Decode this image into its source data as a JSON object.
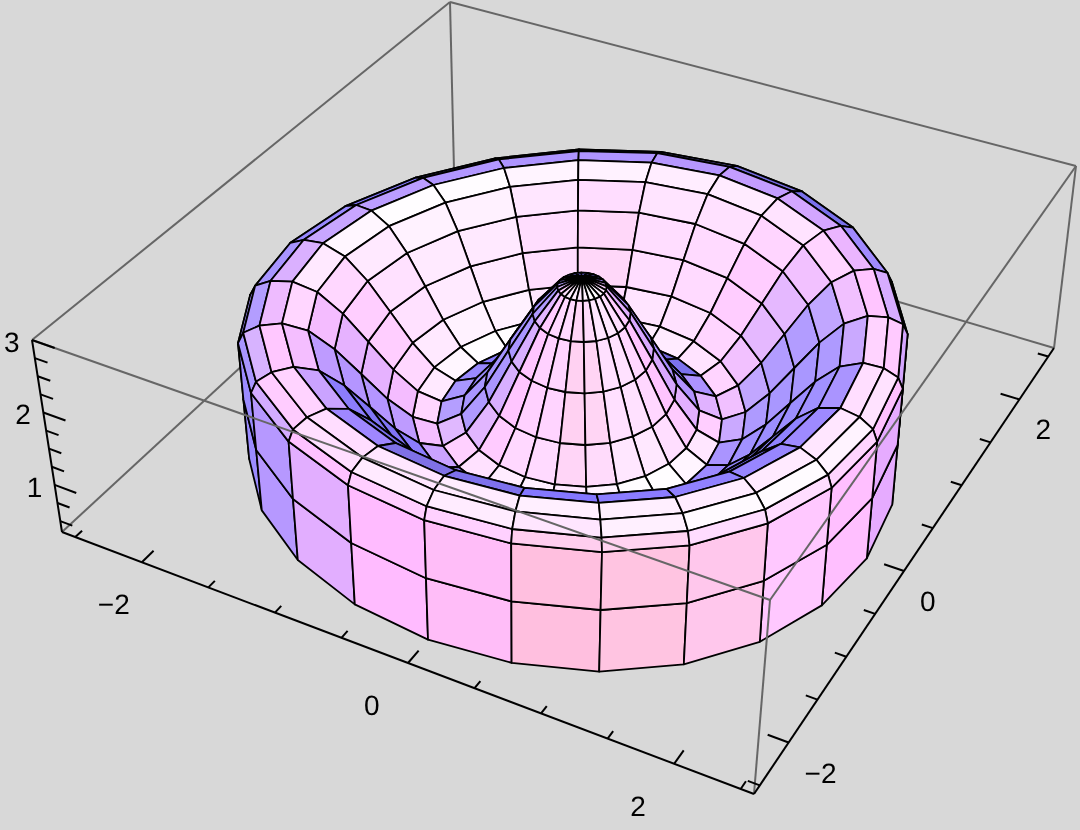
{
  "plot": {
    "z_axis": {
      "ticks": [
        "1",
        "2",
        "3"
      ]
    },
    "x_axis": {
      "ticks": [
        "−2",
        "0",
        "2"
      ]
    },
    "y_axis": {
      "ticks": [
        "−2",
        "0",
        "2"
      ]
    }
  }
}
